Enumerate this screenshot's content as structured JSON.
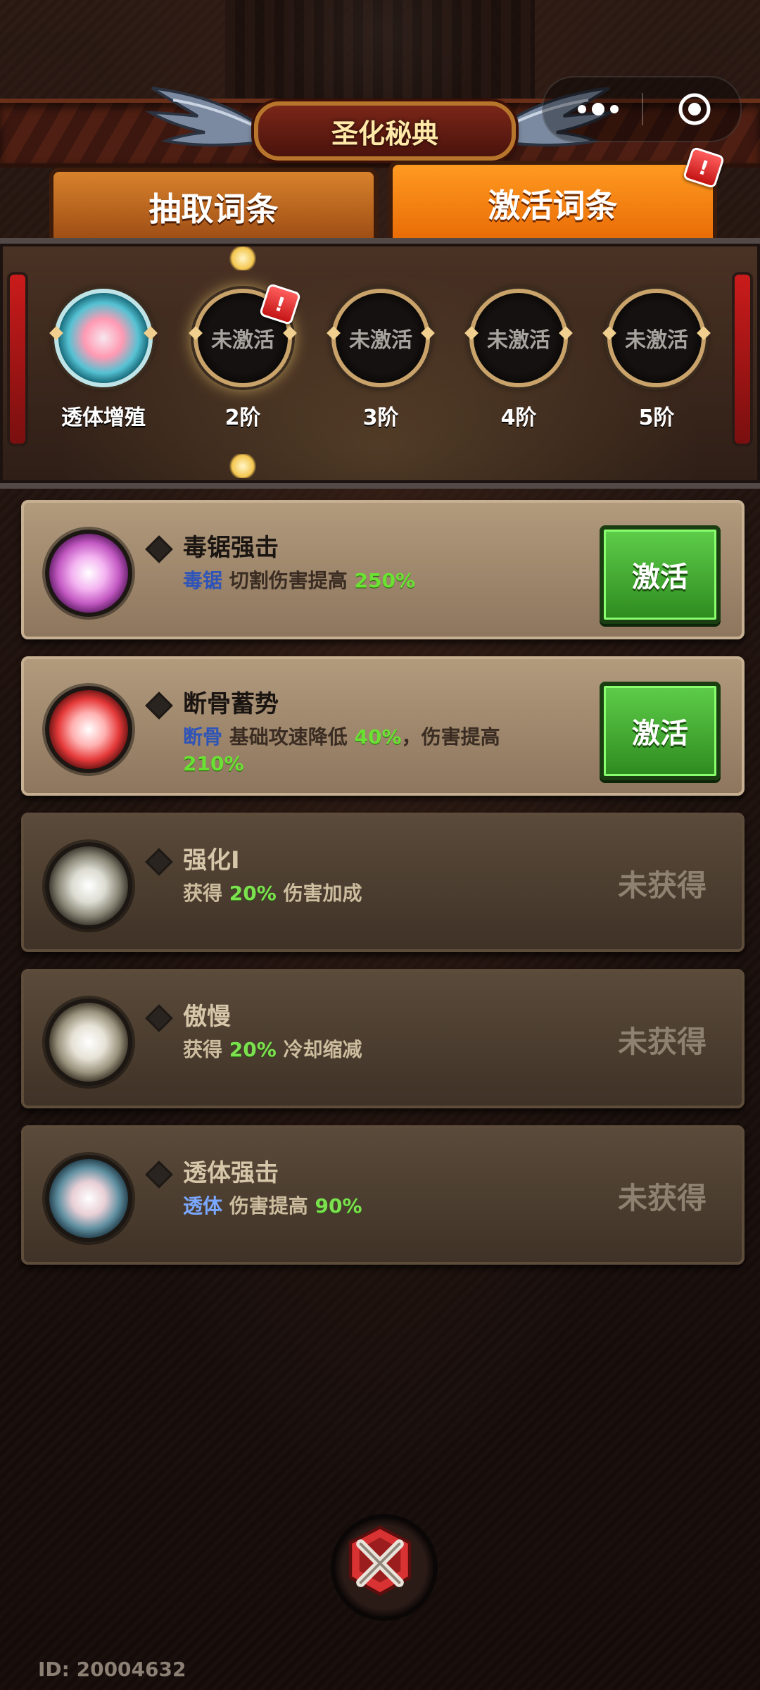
{
  "header": {
    "title": "圣化秘典"
  },
  "tabs": {
    "left_label": "抽取词条",
    "right_label": "激活词条",
    "right_badge": "!"
  },
  "tiers": [
    {
      "ring_text": "",
      "label": "透体增殖"
    },
    {
      "ring_text": "未激活",
      "label": "2阶",
      "badge": "!"
    },
    {
      "ring_text": "未激活",
      "label": "3阶"
    },
    {
      "ring_text": "未激活",
      "label": "4阶"
    },
    {
      "ring_text": "未激活",
      "label": "5阶"
    }
  ],
  "cards": [
    {
      "name": "毒锯强击",
      "desc_tag": "毒锯",
      "desc_text": "切割伤害提高",
      "desc_value": "250%",
      "action": "激活",
      "orb_color": "#d87ad8"
    },
    {
      "name": "断骨蓄势",
      "desc_tag": "断骨",
      "desc_text": "基础攻速降低",
      "desc_value": "40%",
      "desc_text2": "，伤害提高",
      "desc_value2": "210%",
      "action": "激活",
      "orb_color": "#ff5c5c"
    },
    {
      "name": "强化I",
      "desc_prefix": "获得",
      "desc_value": "20%",
      "desc_text": "伤害加成",
      "status": "未获得",
      "orb_color": "#c9c9bd"
    },
    {
      "name": "傲慢",
      "desc_prefix": "获得",
      "desc_value": "20%",
      "desc_text": "冷却缩减",
      "status": "未获得",
      "orb_color": "#d8d4c5"
    },
    {
      "name": "透体强击",
      "desc_tag": "透体",
      "desc_text": "伤害提高",
      "desc_value": "90%",
      "status": "未获得",
      "orb_color": "#7ea9b6"
    }
  ],
  "footer": {
    "id_text": "ID: 20004632"
  },
  "colors": {
    "accent_orange": "#f27a10",
    "button_green": "#3fa52c",
    "highlight_green": "#6be133",
    "highlight_blue": "#2f54b8"
  },
  "icons": {
    "menu": "more-dots-icon",
    "record": "target-icon",
    "close": "close-x-icon",
    "bullet": "diamond-bullet-icon"
  }
}
